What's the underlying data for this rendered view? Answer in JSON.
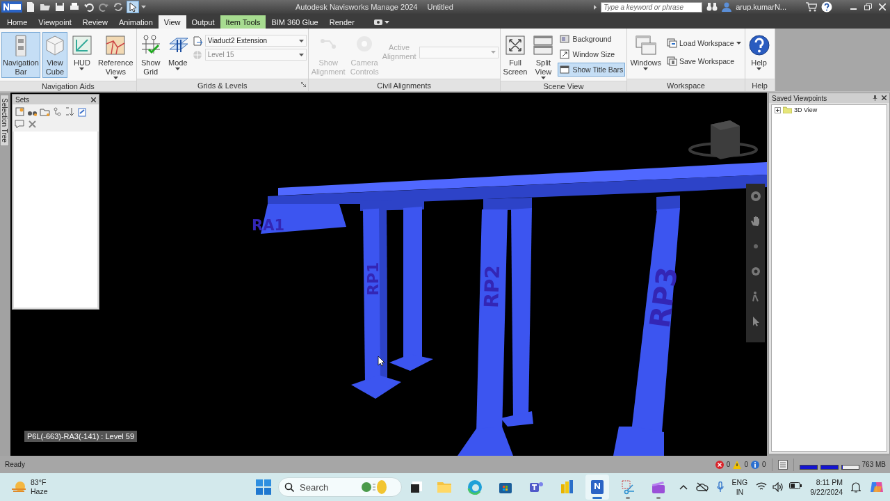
{
  "title_bar": {
    "title": "Autodesk Navisworks Manage 2024",
    "document": "Untitled",
    "search": {
      "placeholder": "Type a keyword or phrase"
    },
    "user": "arup.kumarN..."
  },
  "quick_access": [
    {
      "selected": false
    },
    {
      "selected": false
    },
    {
      "selected": false
    },
    {
      "selected": false
    },
    {
      "selected": false
    },
    {
      "selected": false
    },
    {
      "selected": false
    },
    {
      "selected": true
    }
  ],
  "tabs": [
    {
      "label": "Home",
      "selected": false,
      "kind": "normal"
    },
    {
      "label": "Viewpoint",
      "selected": false,
      "kind": "normal"
    },
    {
      "label": "Review",
      "selected": false,
      "kind": "normal"
    },
    {
      "label": "Animation",
      "selected": false,
      "kind": "normal"
    },
    {
      "label": "View",
      "selected": true,
      "kind": "normal"
    },
    {
      "label": "Output",
      "selected": false,
      "kind": "normal"
    },
    {
      "label": "Item Tools",
      "selected": false,
      "kind": "contextual"
    },
    {
      "label": "BIM 360 Glue",
      "selected": false,
      "kind": "normal"
    },
    {
      "label": "Render",
      "selected": false,
      "kind": "normal"
    }
  ],
  "ribbon": {
    "panels": [
      {
        "title": "Navigation Aids",
        "items": [
          {
            "kind": "large",
            "lines": [
              "Navigation",
              "Bar"
            ],
            "selected": true,
            "disabled": false,
            "menu": false
          },
          {
            "kind": "large",
            "lines": [
              "View",
              "Cube"
            ],
            "selected": true,
            "disabled": false,
            "menu": false
          },
          {
            "kind": "large",
            "lines": [
              "HUD"
            ],
            "selected": false,
            "disabled": false,
            "menu": true
          },
          {
            "kind": "large",
            "lines": [
              "Reference",
              "Views"
            ],
            "selected": false,
            "disabled": false,
            "menu": true
          }
        ]
      },
      {
        "title": "Grids & Levels",
        "launcher": true,
        "items": [
          {
            "kind": "large",
            "lines": [
              "Show",
              "Grid"
            ],
            "selected": false,
            "disabled": false,
            "menu": false
          },
          {
            "kind": "large",
            "lines": [
              "Mode"
            ],
            "selected": false,
            "disabled": false,
            "menu": true
          },
          {
            "kind": "combos",
            "combos": [
              {
                "value": "Viaduct2 Extension",
                "disabled": false
              },
              {
                "value": "Level 15",
                "disabled": true
              }
            ]
          }
        ]
      },
      {
        "title": "Civil Alignments",
        "items": [
          {
            "kind": "large",
            "lines": [
              "Show",
              "Alignment"
            ],
            "selected": false,
            "disabled": true,
            "menu": false
          },
          {
            "kind": "large",
            "lines": [
              "Camera",
              "Controls"
            ],
            "selected": false,
            "disabled": true,
            "menu": false
          },
          {
            "kind": "labeled_combo",
            "lines": [
              "Active",
              "Alignment"
            ],
            "disabled": true
          }
        ]
      },
      {
        "title": "Scene View",
        "items": [
          {
            "kind": "large",
            "lines": [
              "Full",
              "Screen"
            ],
            "selected": false,
            "disabled": false,
            "menu": false
          },
          {
            "kind": "large",
            "lines": [
              "Split",
              "View"
            ],
            "selected": false,
            "disabled": false,
            "menu": true
          },
          {
            "kind": "small_stack",
            "buttons": [
              {
                "label": "Background",
                "selected": false,
                "menu": false
              },
              {
                "label": "Window Size",
                "selected": false,
                "menu": false
              },
              {
                "label": "Show Title Bars",
                "selected": true,
                "menu": false
              }
            ]
          }
        ]
      },
      {
        "title": "Workspace",
        "items": [
          {
            "kind": "large",
            "lines": [
              "Windows"
            ],
            "selected": false,
            "disabled": false,
            "menu": true
          },
          {
            "kind": "small_stack",
            "buttons": [
              {
                "label": "Load Workspace",
                "selected": false,
                "menu": true
              },
              {
                "label": "Save Workspace",
                "selected": false,
                "menu": false
              }
            ]
          }
        ]
      },
      {
        "title": "Help",
        "items": [
          {
            "kind": "large",
            "lines": [
              "Help"
            ],
            "selected": false,
            "disabled": false,
            "menu": true
          }
        ]
      }
    ]
  },
  "side_tab": {
    "label": "Selection Tree"
  },
  "sets_panel": {
    "title": "Sets"
  },
  "viewport": {
    "labels": [
      "RA1",
      "RP1",
      "RP2",
      "RP3"
    ],
    "readout": "P6L(-663)-RA3(-141) : Level 59"
  },
  "saved_viewpoints": {
    "title": "Saved Viewpoints",
    "items": [
      {
        "label": "3D View",
        "expanded": false
      }
    ]
  },
  "status_bar": {
    "text": "Ready",
    "errors": "0",
    "warnings": "0",
    "infos": "0",
    "meters": [
      {
        "level": 1
      },
      {
        "level": 1
      },
      {
        "level": 0
      }
    ],
    "memory": "763 MB"
  },
  "taskbar": {
    "temperature": "83°F",
    "weather": "Haze",
    "search": {
      "placeholder": "Search"
    },
    "apps": [
      {
        "running": false,
        "active": false
      },
      {
        "running": false,
        "active": false
      },
      {
        "running": false,
        "active": false
      },
      {
        "running": false,
        "active": false
      },
      {
        "running": false,
        "active": false
      },
      {
        "running": true,
        "active": true
      },
      {
        "running": true,
        "active": false
      },
      {
        "running": true,
        "active": false
      }
    ],
    "language": "ENG",
    "region": "IN",
    "time": "8:11 PM",
    "date": "9/22/2024"
  }
}
